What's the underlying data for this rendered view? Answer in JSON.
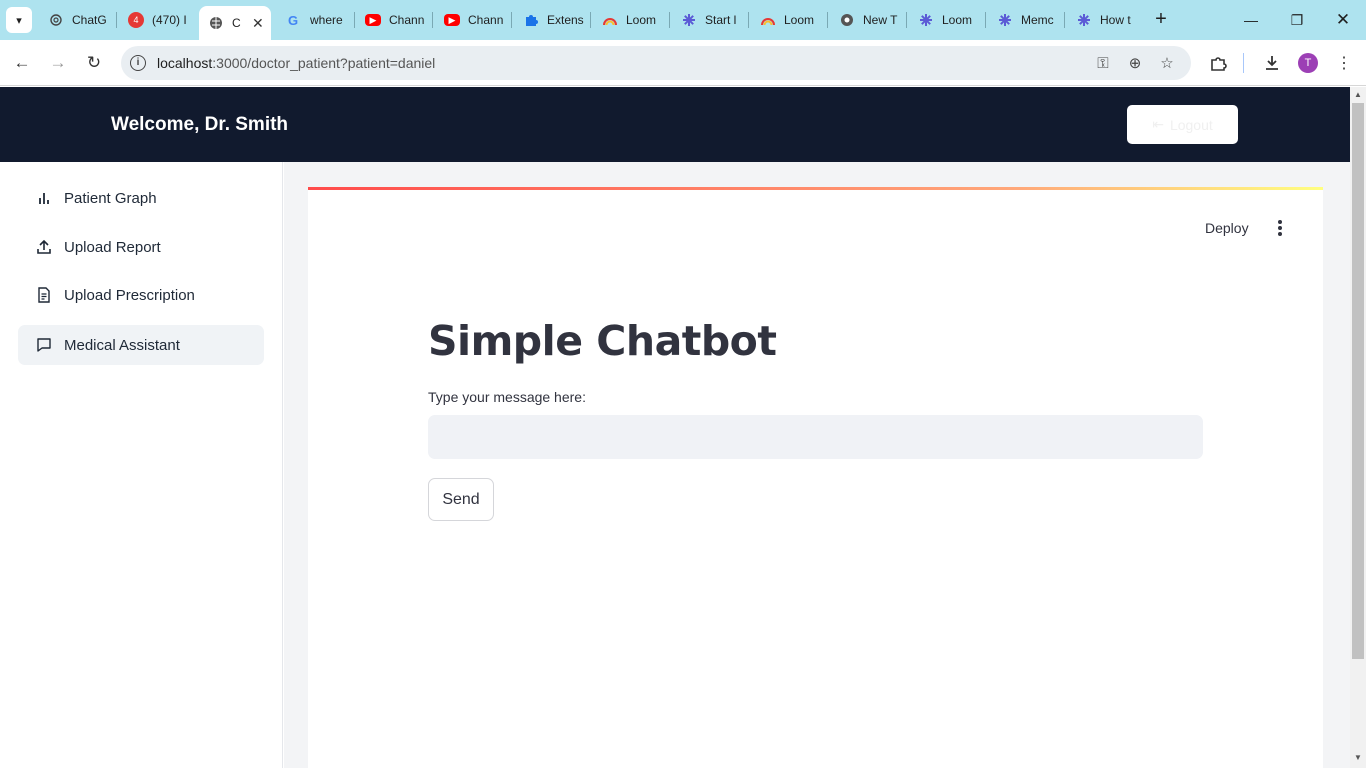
{
  "browser": {
    "tabs": [
      {
        "label": "ChatG",
        "icon": "openai-icon"
      },
      {
        "label": "(470) I",
        "icon": "badge-icon"
      },
      {
        "label": "C",
        "icon": "globe-icon",
        "active": true
      },
      {
        "label": "where",
        "icon": "google-icon"
      },
      {
        "label": "Chann",
        "icon": "youtube-icon"
      },
      {
        "label": "Chann",
        "icon": "youtube-icon"
      },
      {
        "label": "Extens",
        "icon": "puzzle-icon"
      },
      {
        "label": "Loom",
        "icon": "loom-icon"
      },
      {
        "label": "Start l",
        "icon": "asterisk-icon"
      },
      {
        "label": "Loom",
        "icon": "loom-icon"
      },
      {
        "label": "New T",
        "icon": "chrome-icon"
      },
      {
        "label": "Loom",
        "icon": "asterisk-icon"
      },
      {
        "label": "Memc",
        "icon": "asterisk-icon"
      },
      {
        "label": "How t",
        "icon": "asterisk-icon"
      }
    ],
    "url_host": "localhost",
    "url_rest": ":3000/doctor_patient?patient=daniel",
    "avatar_letter": "T"
  },
  "header": {
    "welcome": "Welcome, Dr. Smith",
    "logout_label": "Logout"
  },
  "sidebar": {
    "items": [
      {
        "label": "Patient Graph",
        "icon": "bar-chart-icon"
      },
      {
        "label": "Upload Report",
        "icon": "upload-icon"
      },
      {
        "label": "Upload Prescription",
        "icon": "document-icon"
      },
      {
        "label": "Medical Assistant",
        "icon": "chat-icon",
        "active": true
      }
    ]
  },
  "main": {
    "deploy_label": "Deploy",
    "title": "Simple Chatbot",
    "input_label": "Type your message here:",
    "input_value": "",
    "send_label": "Send"
  },
  "colors": {
    "header_bg": "#111a2e",
    "tabbar_bg": "#aee3ef",
    "accent_gradient_start": "#ff4b4b"
  }
}
